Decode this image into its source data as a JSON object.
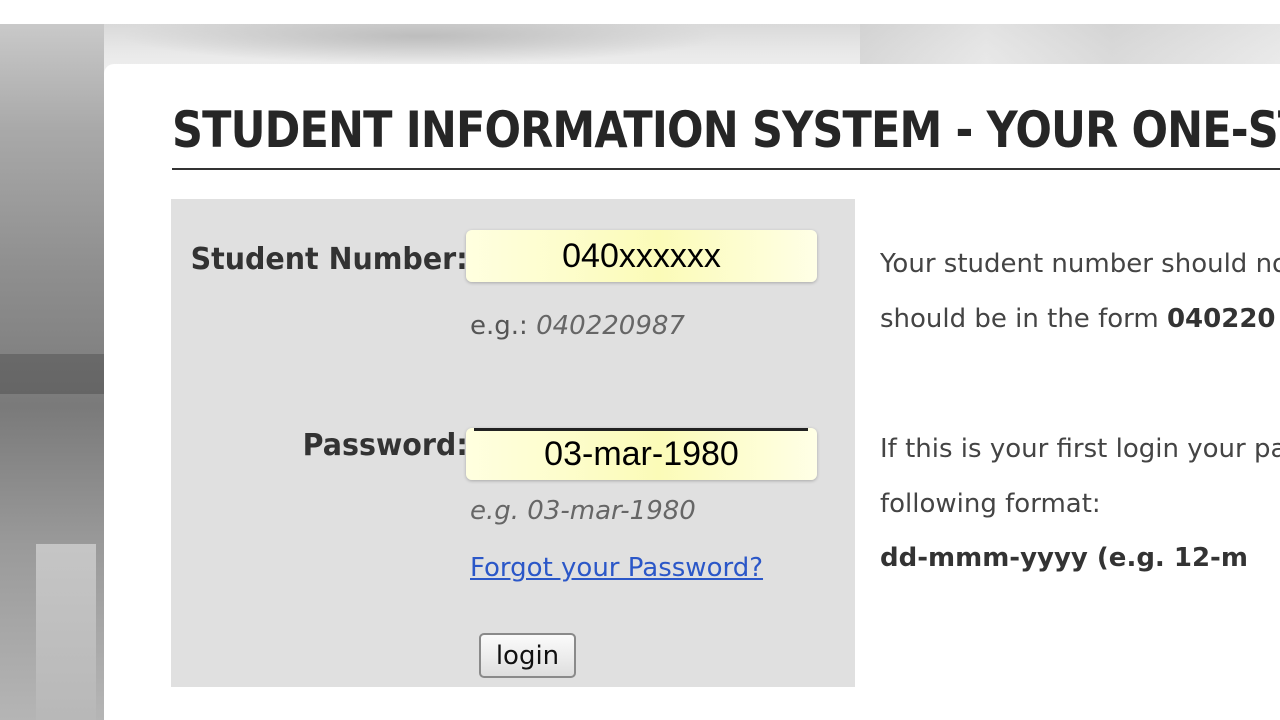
{
  "header": {
    "title": "STUDENT INFORMATION SYSTEM - YOUR ONE-STO"
  },
  "login_form": {
    "student_number": {
      "label": "Student Number:",
      "value": "040xxxxxx",
      "hint_prefix": "e.g.: ",
      "hint_example": "040220987"
    },
    "password": {
      "label": "Password:",
      "value": "03-mar-1980",
      "hint": "e.g. 03-mar-1980"
    },
    "forgot_link": "Forgot your Password?",
    "login_button": "login"
  },
  "help_text": {
    "student_line1": "Your student number should no",
    "student_line2_prefix": "should be in the form ",
    "student_line2_bold": "040220",
    "password_line1": "If this is your first login your pa",
    "password_line2": "following format:",
    "password_line3": "dd-mmm-yyyy (e.g. 12-m"
  },
  "colors": {
    "panel_background": "#e0e0e0",
    "field_highlight": "#fbfbb8",
    "link": "#2b57c8"
  }
}
